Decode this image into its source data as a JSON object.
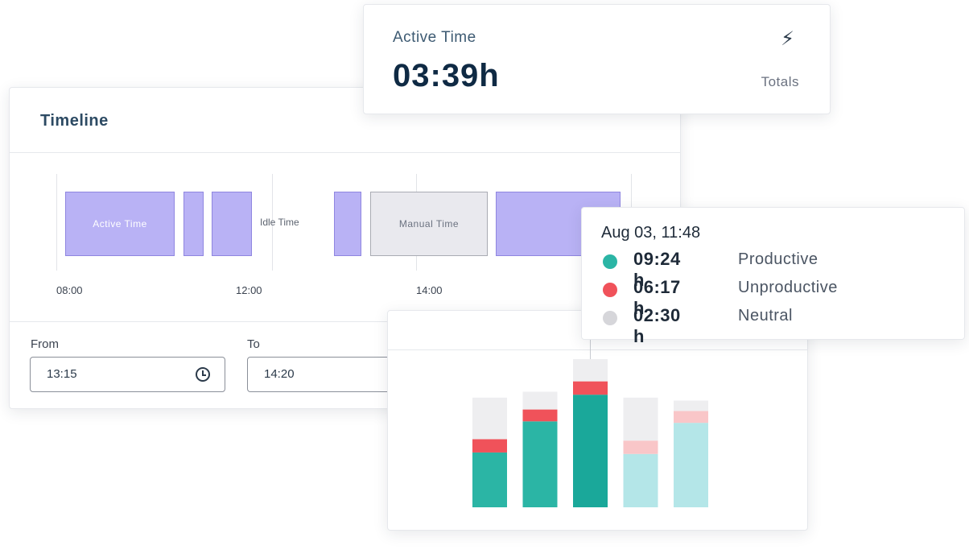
{
  "active_time": {
    "label": "Active Time",
    "value": "03:39h",
    "totals_label": "Totals",
    "icon": "bolt-icon"
  },
  "timeline": {
    "title": "Timeline",
    "segments": [
      {
        "label": "Active Time",
        "type": "active"
      },
      {
        "label": "",
        "type": "active"
      },
      {
        "label": "",
        "type": "active"
      },
      {
        "label": "",
        "type": "active"
      },
      {
        "label": "Manual Time",
        "type": "manual"
      },
      {
        "label": "",
        "type": "active"
      }
    ],
    "idle_label": "Idle Time",
    "ticks": [
      "08:00",
      "12:00",
      "14:00"
    ],
    "from": {
      "label": "From",
      "value": "13:15"
    },
    "to": {
      "label": "To",
      "value": "14:20"
    }
  },
  "tooltip": {
    "date": "Aug 03, 11:48",
    "rows": [
      {
        "value": "09:24 h",
        "label": "Productive",
        "color": "#2bb5a5"
      },
      {
        "value": "06:17 h",
        "label": "Unproductive",
        "color": "#f0525a"
      },
      {
        "value": "02:30 h",
        "label": "Neutral",
        "color": "#d6d6da"
      }
    ]
  },
  "colors": {
    "productive": "#2bb5a5",
    "productive_highlight": "#1aa89a",
    "productive_light": "#b4e6e8",
    "unproductive": "#f0525a",
    "unproductive_light": "#f9c6c8",
    "neutral": "#eeeef0",
    "active_segment": "#b9b2f5",
    "manual_segment": "#e9e9ee"
  },
  "chart_data": {
    "type": "bar",
    "stacked": true,
    "categories": [
      "",
      "",
      "",
      "",
      ""
    ],
    "series": [
      {
        "values": [
          37,
          58,
          76,
          36,
          57
        ]
      },
      {
        "values": [
          9,
          8,
          9,
          9,
          8
        ]
      },
      {
        "values": [
          28,
          12,
          15,
          29,
          7
        ]
      }
    ],
    "ylim": [
      0,
      100
    ],
    "highlighted_index": 2,
    "grid": false
  }
}
